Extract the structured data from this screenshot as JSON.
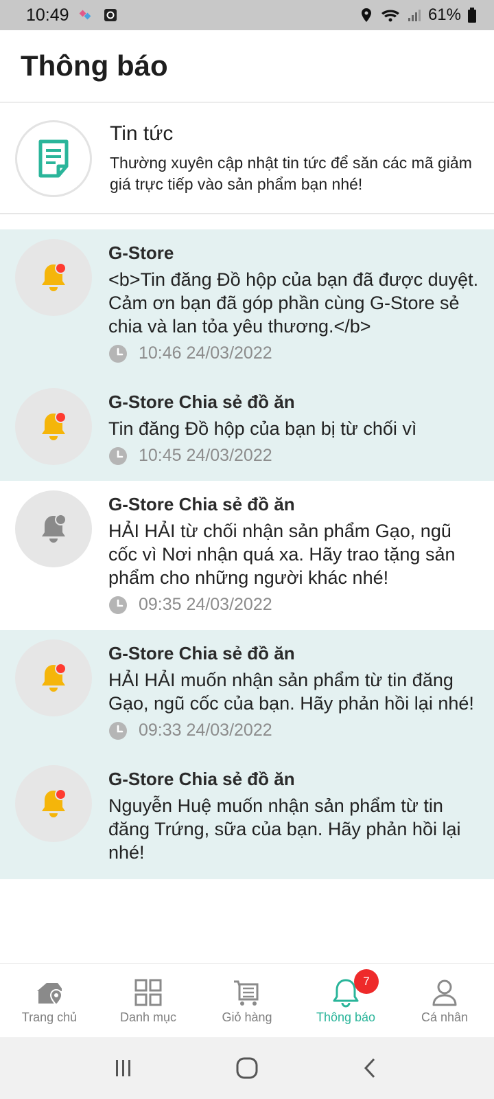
{
  "status_bar": {
    "time": "10:49",
    "battery": "61%",
    "icons": [
      "sim-swap-icon",
      "screen-record-icon",
      "location-icon",
      "wifi-icon",
      "signal-icon",
      "battery-icon"
    ]
  },
  "header": {
    "title": "Thông báo"
  },
  "news": {
    "title": "Tin tức",
    "description": "Thường xuyên cập nhật tin tức để săn các mã giảm giá trực tiếp vào sản phẩm bạn nhé!",
    "icon": "document-icon"
  },
  "notifications": [
    {
      "title": "G-Store",
      "message": "<b>Tin đăng Đồ hộp  của bạn đã được duyệt. Cảm ơn bạn đã góp phần cùng G-Store sẻ chia và lan tỏa yêu thương.</b>",
      "time": "10:46 24/03/2022",
      "unread": true
    },
    {
      "title": "G-Store Chia sẻ đồ ăn",
      "message": "Tin đăng Đồ hộp  của bạn bị từ chối vì",
      "time": "10:45 24/03/2022",
      "unread": true
    },
    {
      "title": "G-Store Chia sẻ đồ ăn",
      "message": "HẢI HẢI từ chối nhận sản phẩm Gạo, ngũ cốc  vì Nơi nhận quá xa. Hãy trao tặng sản phẩm cho những người khác nhé!",
      "time": "09:35 24/03/2022",
      "unread": false
    },
    {
      "title": "G-Store Chia sẻ đồ ăn",
      "message": "HẢI HẢI muốn nhận sản phẩm từ tin đăng Gạo, ngũ cốc  của bạn. Hãy phản hồi lại nhé!",
      "time": "09:33 24/03/2022",
      "unread": true
    },
    {
      "title": "G-Store Chia sẻ đồ ăn",
      "message": "Nguyễn Huệ muốn nhận sản phẩm từ tin đăng Trứng, sữa  của bạn. Hãy phản hồi lại nhé!",
      "time": "",
      "unread": true
    }
  ],
  "bottom_nav": {
    "items": [
      {
        "label": "Trang chủ",
        "icon": "home-location-icon"
      },
      {
        "label": "Danh mục",
        "icon": "grid-icon"
      },
      {
        "label": "Giỏ hàng",
        "icon": "cart-icon"
      },
      {
        "label": "Thông báo",
        "icon": "bell-icon",
        "active": true,
        "badge": "7"
      },
      {
        "label": "Cá nhân",
        "icon": "user-icon"
      }
    ]
  },
  "colors": {
    "accent": "#2ab59a",
    "unread_bg": "#e4f1f1",
    "badge": "#ee2a2a",
    "bell_yellow": "#f5b50a"
  }
}
